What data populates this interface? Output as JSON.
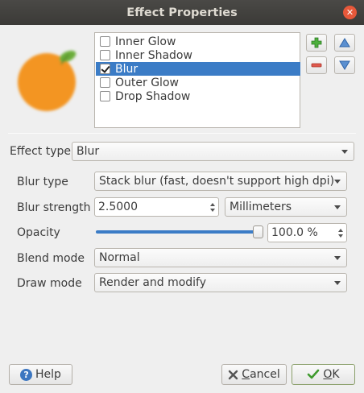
{
  "window": {
    "title": "Effect Properties"
  },
  "effects": {
    "items": [
      {
        "label": "Inner Glow",
        "checked": false,
        "selected": false
      },
      {
        "label": "Inner Shadow",
        "checked": false,
        "selected": false
      },
      {
        "label": "Blur",
        "checked": true,
        "selected": true
      },
      {
        "label": "Outer Glow",
        "checked": false,
        "selected": false
      },
      {
        "label": "Drop Shadow",
        "checked": false,
        "selected": false
      }
    ]
  },
  "form": {
    "effect_type_label": "Effect type",
    "effect_type_value": "Blur",
    "blur_type_label": "Blur type",
    "blur_type_value": "Stack blur (fast, doesn't support high dpi)",
    "blur_strength_label": "Blur strength",
    "blur_strength_value": "2.5000",
    "blur_unit_value": "Millimeters",
    "opacity_label": "Opacity",
    "opacity_value": "100.0 %",
    "opacity_fraction": 1.0,
    "blend_mode_label": "Blend mode",
    "blend_mode_value": "Normal",
    "draw_mode_label": "Draw mode",
    "draw_mode_value": "Render and modify"
  },
  "buttons": {
    "help": "Help",
    "cancel_mnemonic": "C",
    "cancel_rest": "ancel",
    "ok_mnemonic": "O",
    "ok_rest": "K"
  },
  "colors": {
    "accent": "#3b7cc6",
    "titlebar": "#3f3e3b",
    "close": "#e7583a",
    "add_green": "#3a9a3a",
    "remove_red": "#d9534f"
  },
  "icons": {
    "close": "close-icon",
    "add": "plus-icon",
    "remove": "minus-icon",
    "up": "arrow-up-icon",
    "down": "arrow-down-icon",
    "help": "help-icon",
    "cancel": "cancel-icon",
    "ok": "checkmark-icon"
  }
}
